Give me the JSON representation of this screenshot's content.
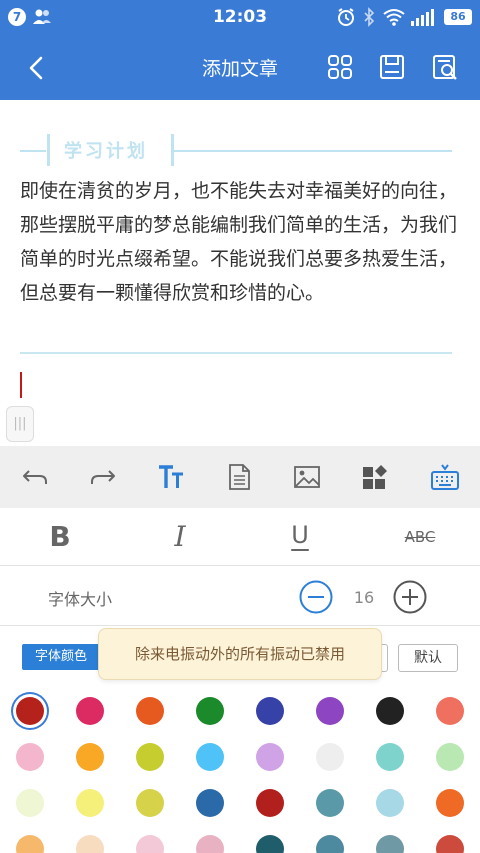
{
  "status_bar": {
    "notification_count": "7",
    "time": "12:03",
    "battery": "86"
  },
  "app_bar": {
    "title": "添加文章"
  },
  "editor": {
    "section_heading": "学习计划",
    "article_text": "即使在清贫的岁月，也不能失去对幸福美好的向往，那些摆脱平庸的梦总能编制我们简单的生活，为我们简单的时光点缀希望。不能说我们总要多热爱生活，但总要有一颗懂得欣赏和珍惜的心。",
    "handle_glyph": "|||"
  },
  "format": {
    "bold": "B",
    "italic": "I",
    "underline": "U",
    "strikethrough": "ABC"
  },
  "font_size": {
    "label": "字体大小",
    "value": "16"
  },
  "font_color": {
    "tab_label": "字体颜色",
    "reset_label": "默认"
  },
  "toast": {
    "message": "除来电振动外的所有振动已禁用"
  },
  "colors": {
    "accent": "#3a7bd5",
    "swatches": [
      [
        "#b5221c",
        "#dc2a63",
        "#e65a1f",
        "#1a8a2a",
        "#3742a8",
        "#8d45c2",
        "#222222",
        "#f0705f"
      ],
      [
        "#f4b6cc",
        "#f9a825",
        "#c6cd2e",
        "#4fc3f7",
        "#cfa3e6",
        "#eeeeee",
        "#7fd3cd",
        "#b9e8b3"
      ],
      [
        "#eef6d3",
        "#f5f07a",
        "#d6d24a",
        "#2a6aa9",
        "#b2201d",
        "#5a9aa8",
        "#a6d8e6",
        "#ee6a25"
      ],
      [
        "#f6b86a",
        "#f7dcbf",
        "#f3c9d7",
        "#e9b2c2",
        "#1f5d6b",
        "#4d8aa0",
        "#7099a6",
        "#cc4b3c"
      ]
    ],
    "selected_index": 0
  }
}
